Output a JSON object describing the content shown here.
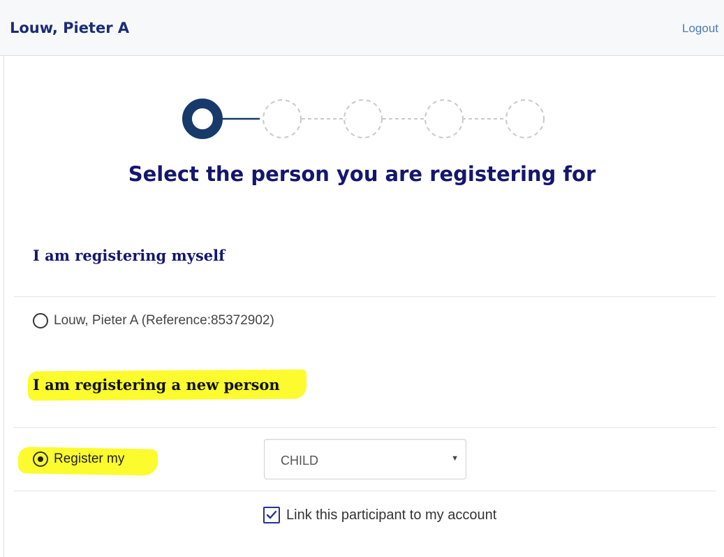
{
  "header": {
    "user_name": "Louw, Pieter A",
    "logout_label": "Logout"
  },
  "stepper": {
    "total_steps": 5,
    "current_step": 1
  },
  "page_title": "Select the person you are registering for",
  "section_myself": {
    "heading": "I am registering myself",
    "option_label": "Louw, Pieter A (Reference:85372902)",
    "selected": false
  },
  "section_new": {
    "heading": "I am registering a new person",
    "option_label": "Register my",
    "selected": true,
    "relationship_select": {
      "value": "CHILD"
    }
  },
  "link_checkbox": {
    "label": "Link this participant to my account",
    "checked": true
  },
  "colors": {
    "brand_navy": "#14166e",
    "stepper_active": "#173a6b",
    "highlight": "#fbfb2e",
    "link": "#4a7ab8"
  },
  "icons": {
    "radio_unselected": "radio-empty-icon",
    "radio_selected": "radio-filled-icon",
    "checkbox": "checkmark-icon",
    "select_arrow": "caret-down-icon"
  }
}
